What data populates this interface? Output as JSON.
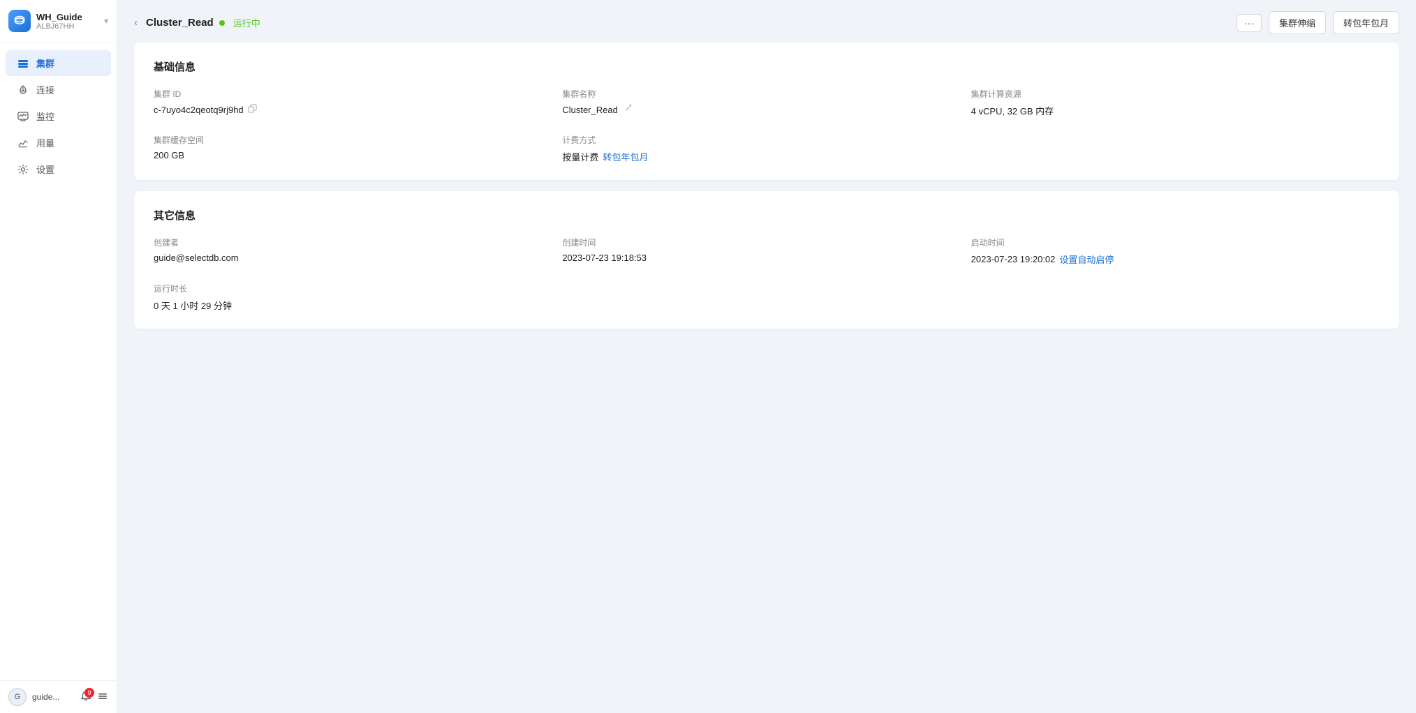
{
  "sidebar": {
    "logo_alt": "SelectDB Logo",
    "workspace_name": "WH_Guide",
    "workspace_id": "ALBJ67HH",
    "nav_items": [
      {
        "id": "cluster",
        "label": "集群",
        "active": true
      },
      {
        "id": "connect",
        "label": "连接",
        "active": false
      },
      {
        "id": "monitor",
        "label": "监控",
        "active": false
      },
      {
        "id": "usage",
        "label": "用量",
        "active": false
      },
      {
        "id": "settings",
        "label": "设置",
        "active": false
      }
    ],
    "user": {
      "avatar_text": "G",
      "name": "guide...",
      "notification_count": "9"
    }
  },
  "topbar": {
    "back_label": "Cluster_Read",
    "cluster_name": "Cluster_Read",
    "status_text": "运行中",
    "btn_more": "···",
    "btn_scale": "集群伸缩",
    "btn_convert": "转包年包月"
  },
  "basic_info": {
    "section_title": "基础信息",
    "cluster_id_label": "集群 ID",
    "cluster_id_value": "c-7uyo4c2qeotq9rj9hd",
    "cluster_name_label": "集群名称",
    "cluster_name_value": "Cluster_Read",
    "cluster_resources_label": "集群计算资源",
    "cluster_resources_value": "4 vCPU, 32 GB 内存",
    "cluster_storage_label": "集群缓存空间",
    "cluster_storage_value": "200 GB",
    "billing_label": "计费方式",
    "billing_prefix": "按量计费",
    "billing_link": "转包年包月"
  },
  "other_info": {
    "section_title": "其它信息",
    "creator_label": "创建者",
    "creator_value": "guide@selectdb.com",
    "created_time_label": "创建时间",
    "created_time_value": "2023-07-23 19:18:53",
    "start_time_label": "启动时间",
    "start_time_value": "2023-07-23 19:20:02",
    "start_time_link": "设置自动启停",
    "runtime_label": "运行时长",
    "runtime_value": "0 天 1 小时 29 分钟"
  }
}
